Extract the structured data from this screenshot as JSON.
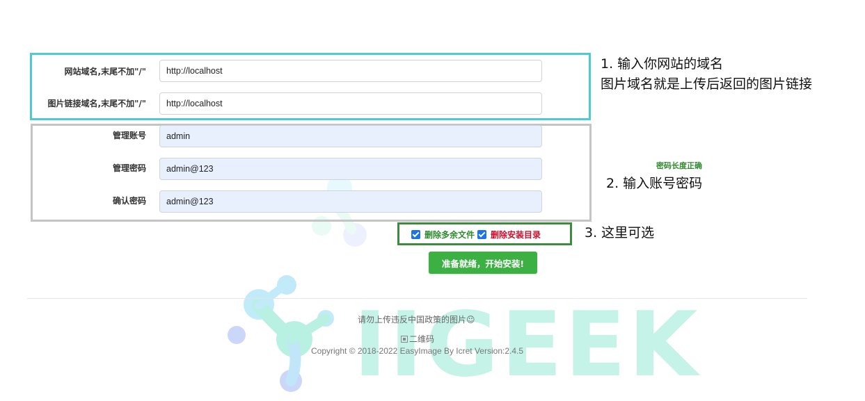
{
  "form": {
    "site_domain": {
      "label": "网站域名,末尾不加\"/\"",
      "value": "http://localhost"
    },
    "image_domain": {
      "label": "图片链接域名,末尾不加\"/\"",
      "value": "http://localhost"
    },
    "admin_account": {
      "label": "管理账号",
      "value": "admin"
    },
    "admin_password": {
      "label": "管理密码",
      "value": "admin@123"
    },
    "confirm_password": {
      "label": "确认密码",
      "value": "admin@123"
    },
    "password_hint": "密码长度正确"
  },
  "options": {
    "delete_extra_files": {
      "label": "删除多余文件",
      "checked": true
    },
    "delete_install_dir": {
      "label": "删除安装目录",
      "checked": true
    }
  },
  "submit": {
    "label": "准备就绪，开始安装!",
    "color": "#3cb043"
  },
  "annotations": {
    "step1_line1": "1.  输入你网站的域名",
    "step1_line2": "图片域名就是上传后返回的图片链接",
    "step2": "2. 输入账号密码",
    "step3": "3. 这里可选"
  },
  "footer": {
    "warning": "请勿上传违反中国政策的图片☺",
    "qr": "二维码",
    "copyright": "Copyright © 2018-2022 EasyImage By Icret Version:2.4.5"
  },
  "watermark": {
    "text": "IIGEEK"
  },
  "colors": {
    "domain_box": "#4ecad3",
    "account_box": "#c4c4c4",
    "options_box": "#3d8b3d",
    "checkbox": "#1a73e8",
    "hint_green": "#2e8b2e",
    "warn_red": "#c8102e"
  }
}
